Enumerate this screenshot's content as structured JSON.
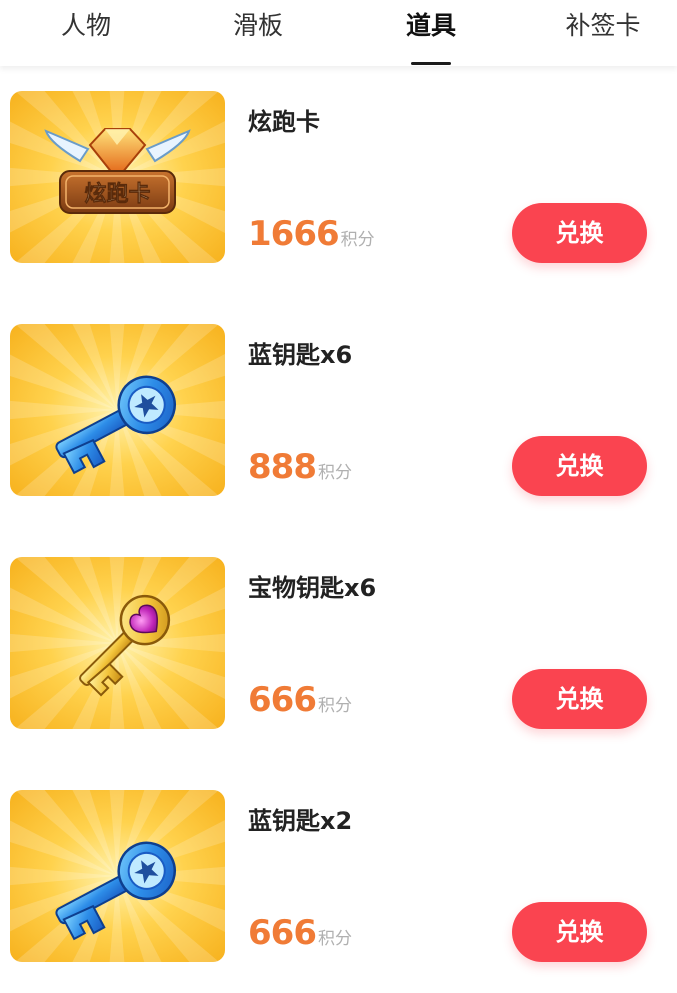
{
  "tabs": [
    {
      "label": "人物"
    },
    {
      "label": "滑板"
    },
    {
      "label": "道具"
    },
    {
      "label": "补签卡"
    }
  ],
  "active_tab": "道具",
  "items": [
    {
      "name": "炫跑卡",
      "price": "1666",
      "unit": "积分",
      "button": "兑换",
      "image": "flash-run-card-icon",
      "image_text": "炫跑卡"
    },
    {
      "name": "蓝钥匙x6",
      "price": "888",
      "unit": "积分",
      "button": "兑换",
      "image": "blue-key-icon"
    },
    {
      "name": "宝物钥匙x6",
      "price": "666",
      "unit": "积分",
      "button": "兑换",
      "image": "treasure-key-icon"
    },
    {
      "name": "蓝钥匙x2",
      "price": "666",
      "unit": "积分",
      "button": "兑换",
      "image": "blue-key-icon"
    }
  ],
  "colors": {
    "accent": "#fa4450",
    "price": "#f07b36",
    "thumb_bg": "#fdc234"
  }
}
